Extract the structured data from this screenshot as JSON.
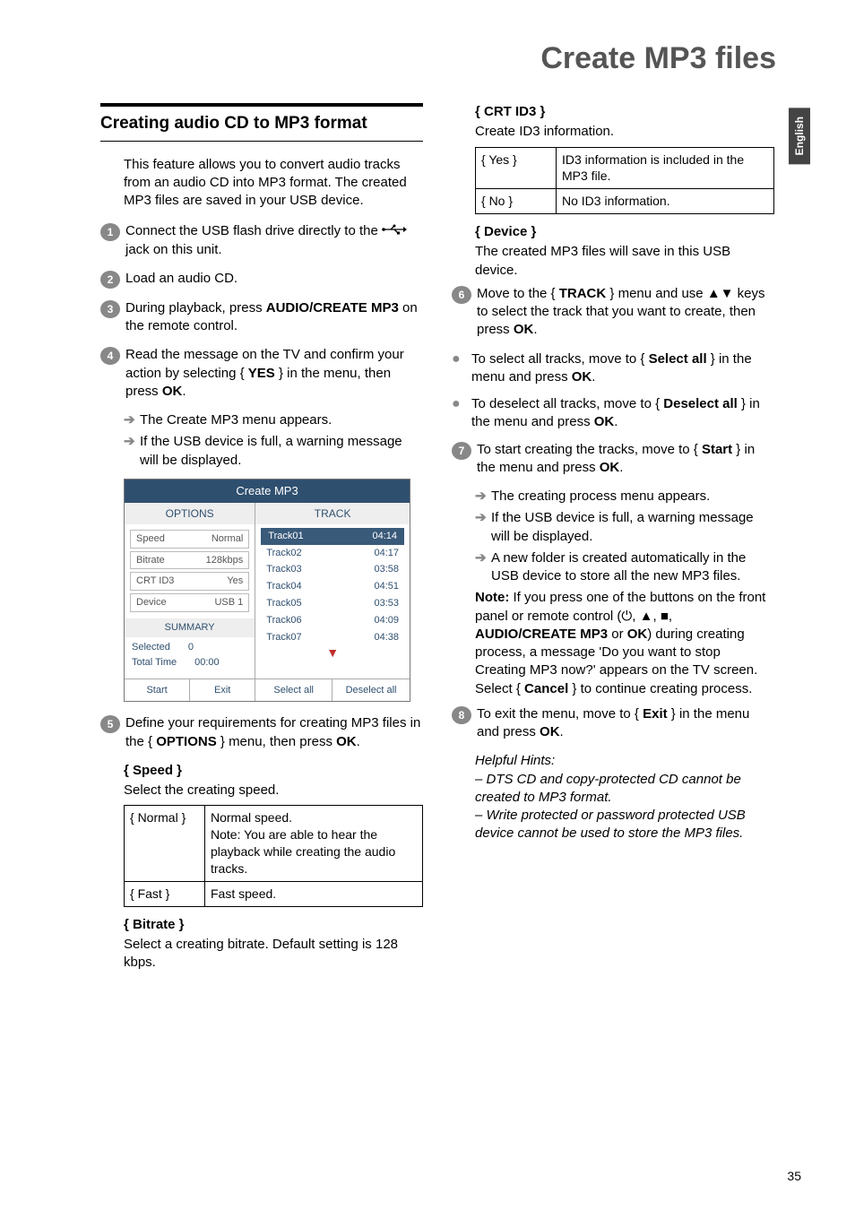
{
  "page_title": "Create MP3 files",
  "side_tab": "English",
  "page_number": "35",
  "left": {
    "heading": "Creating audio CD to MP3 format",
    "desc": "This feature allows you to convert audio tracks from an audio CD into MP3 format. The created MP3 files are saved in your USB device.",
    "step1a": "Connect the USB flash drive directly to the ",
    "step1b": " jack on this unit.",
    "step2": "Load an audio CD.",
    "step3a": "During playback, press ",
    "step3b": "AUDIO/CREATE MP3",
    "step3c": " on the remote control.",
    "step4a": "Read the message on the TV and confirm your action by selecting { ",
    "step4b": "YES",
    "step4c": " } in the menu, then press ",
    "step4d": "OK",
    "step4e": ".",
    "step4_sub1": "The Create MP3 menu appears.",
    "step4_sub2": "If the USB device is full, a warning message will be displayed.",
    "step5a": "Define your requirements for creating MP3 files in the { ",
    "step5b": "OPTIONS",
    "step5c": " } menu, then press ",
    "step5d": "OK",
    "step5e": ".",
    "speed_h": "{ Speed }",
    "speed_d": "Select the creating speed.",
    "speed_tbl": [
      [
        "{ Normal }",
        "Normal speed.\nNote:  You are able to hear the playback while creating the audio tracks."
      ],
      [
        "{ Fast }",
        "Fast speed."
      ]
    ],
    "bitrate_h": "{ Bitrate }",
    "bitrate_d": "Select a creating bitrate.  Default setting is 128 kbps."
  },
  "right": {
    "crt_h": "{ CRT ID3 }",
    "crt_d": "Create ID3 information.",
    "crt_tbl": [
      [
        "{ Yes }",
        "ID3 information is included in the MP3 file."
      ],
      [
        "{ No }",
        "No ID3 information."
      ]
    ],
    "device_h": "{ Device }",
    "device_d": "The created MP3 files will save in this USB device.",
    "step6a": "Move to the { ",
    "step6b": "TRACK",
    "step6c": " } menu and use ▲▼ keys to select the track that you want to create, then press ",
    "step6d": "OK",
    "step6e": ".",
    "bullet1a": "To select all tracks, move to { ",
    "bullet1b": "Select all",
    "bullet1c": " } in the menu and press ",
    "bullet1d": "OK",
    "bullet1e": ".",
    "bullet2a": "To deselect all tracks, move to { ",
    "bullet2b": "Deselect all",
    "bullet2c": " } in the menu and press ",
    "bullet2d": "OK",
    "bullet2e": ".",
    "step7a": "To start creating the tracks, move to { ",
    "step7b": "Start",
    "step7c": " } in the menu and press ",
    "step7d": "OK",
    "step7e": ".",
    "step7_sub1": "The creating process menu appears.",
    "step7_sub2": "If the USB device is full, a warning message will be displayed.",
    "step7_sub3": "A new folder is created automatically in the USB device to store all the new MP3 files.",
    "note1a": "Note:",
    "note1b": " If you press one of the buttons on the front panel or remote control (",
    "note1c": ", ",
    "note1d": "AUDIO/CREATE MP3",
    "note1e": " or ",
    "note1f": "OK",
    "note1g": ") during creating process, a message 'Do you want to stop Creating MP3 now?' appears on the TV screen. Select { ",
    "note1h": "Cancel",
    "note1i": " } to continue creating process.",
    "step8a": "To exit the menu, move to { ",
    "step8b": "Exit",
    "step8c": " } in the menu and press ",
    "step8d": "OK",
    "step8e": ".",
    "hints_h": "Helpful Hints:",
    "hints1": "–  DTS CD and copy-protected CD cannot be created to MP3 format.",
    "hints2": "–  Write protected or password protected USB device cannot be used to store the MP3 files."
  },
  "panel": {
    "title": "Create MP3",
    "opt_hdr": "OPTIONS",
    "trk_hdr": "TRACK",
    "options": [
      [
        "Speed",
        "Normal"
      ],
      [
        "Bitrate",
        "128kbps"
      ],
      [
        "CRT ID3",
        "Yes"
      ],
      [
        "Device",
        "USB 1"
      ]
    ],
    "summary_hdr": "SUMMARY",
    "summary": [
      [
        "Selected",
        "0"
      ],
      [
        "Total Time",
        "00:00"
      ]
    ],
    "tracks": [
      [
        "Track01",
        "04:14"
      ],
      [
        "Track02",
        "04:17"
      ],
      [
        "Track03",
        "03:58"
      ],
      [
        "Track04",
        "04:51"
      ],
      [
        "Track05",
        "03:53"
      ],
      [
        "Track06",
        "04:09"
      ],
      [
        "Track07",
        "04:38"
      ]
    ],
    "bottom": [
      "Start",
      "Exit",
      "Select all",
      "Deselect all"
    ]
  }
}
